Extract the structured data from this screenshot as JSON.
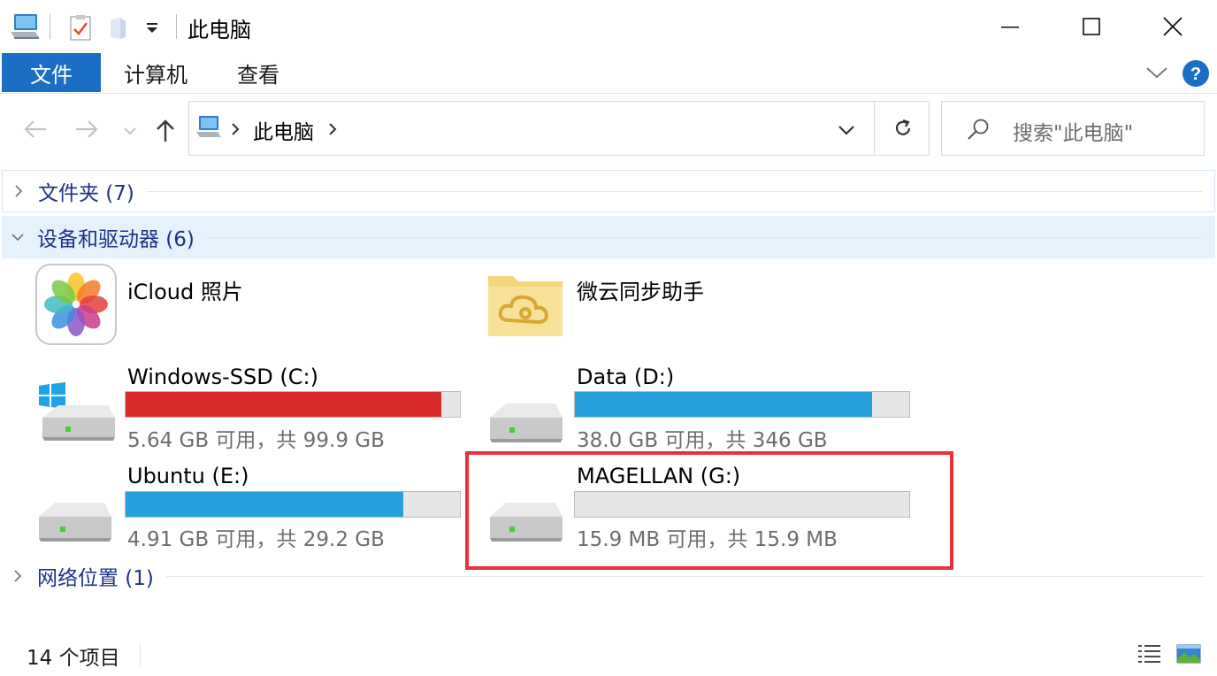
{
  "window": {
    "title": "此电脑"
  },
  "ribbon": {
    "tabs": [
      {
        "label": "文件",
        "active": true
      },
      {
        "label": "计算机"
      },
      {
        "label": "查看"
      }
    ]
  },
  "address": {
    "path": "此电脑",
    "search_placeholder": "搜索\"此电脑\""
  },
  "groups": {
    "folders": {
      "label": "文件夹 (7)",
      "expanded": false
    },
    "devices": {
      "label": "设备和驱动器 (6)",
      "expanded": true
    },
    "network": {
      "label": "网络位置 (1)",
      "expanded": false
    }
  },
  "devices": {
    "apps": [
      {
        "name": "iCloud 照片",
        "icon": "photos-app-icon"
      },
      {
        "name": "微云同步助手",
        "icon": "weiyun-folder-icon"
      }
    ],
    "drives": [
      {
        "name": "Windows-SSD (C:)",
        "detail": "5.64 GB 可用，共 99.9 GB",
        "used_fraction": 0.944,
        "bar_color": "#da2a2a",
        "icon": "windows-drive-icon"
      },
      {
        "name": "Data (D:)",
        "detail": "38.0 GB 可用，共 346 GB",
        "used_fraction": 0.89,
        "bar_color": "#26a0da",
        "icon": "hard-drive-icon"
      },
      {
        "name": "Ubuntu (E:)",
        "detail": "4.91 GB 可用，共 29.2 GB",
        "used_fraction": 0.832,
        "bar_color": "#26a0da",
        "icon": "hard-drive-icon"
      },
      {
        "name": "MAGELLAN (G:)",
        "detail": "15.9 MB 可用，共 15.9 MB",
        "used_fraction": 0.0,
        "bar_color": "#26a0da",
        "icon": "hard-drive-icon",
        "highlighted": true
      }
    ]
  },
  "statusbar": {
    "item_count": "14 个项目"
  },
  "colors": {
    "accent": "#1a6fc4",
    "low_space": "#da2a2a",
    "normal_space": "#26a0da",
    "highlight_box": "#e8313a"
  }
}
